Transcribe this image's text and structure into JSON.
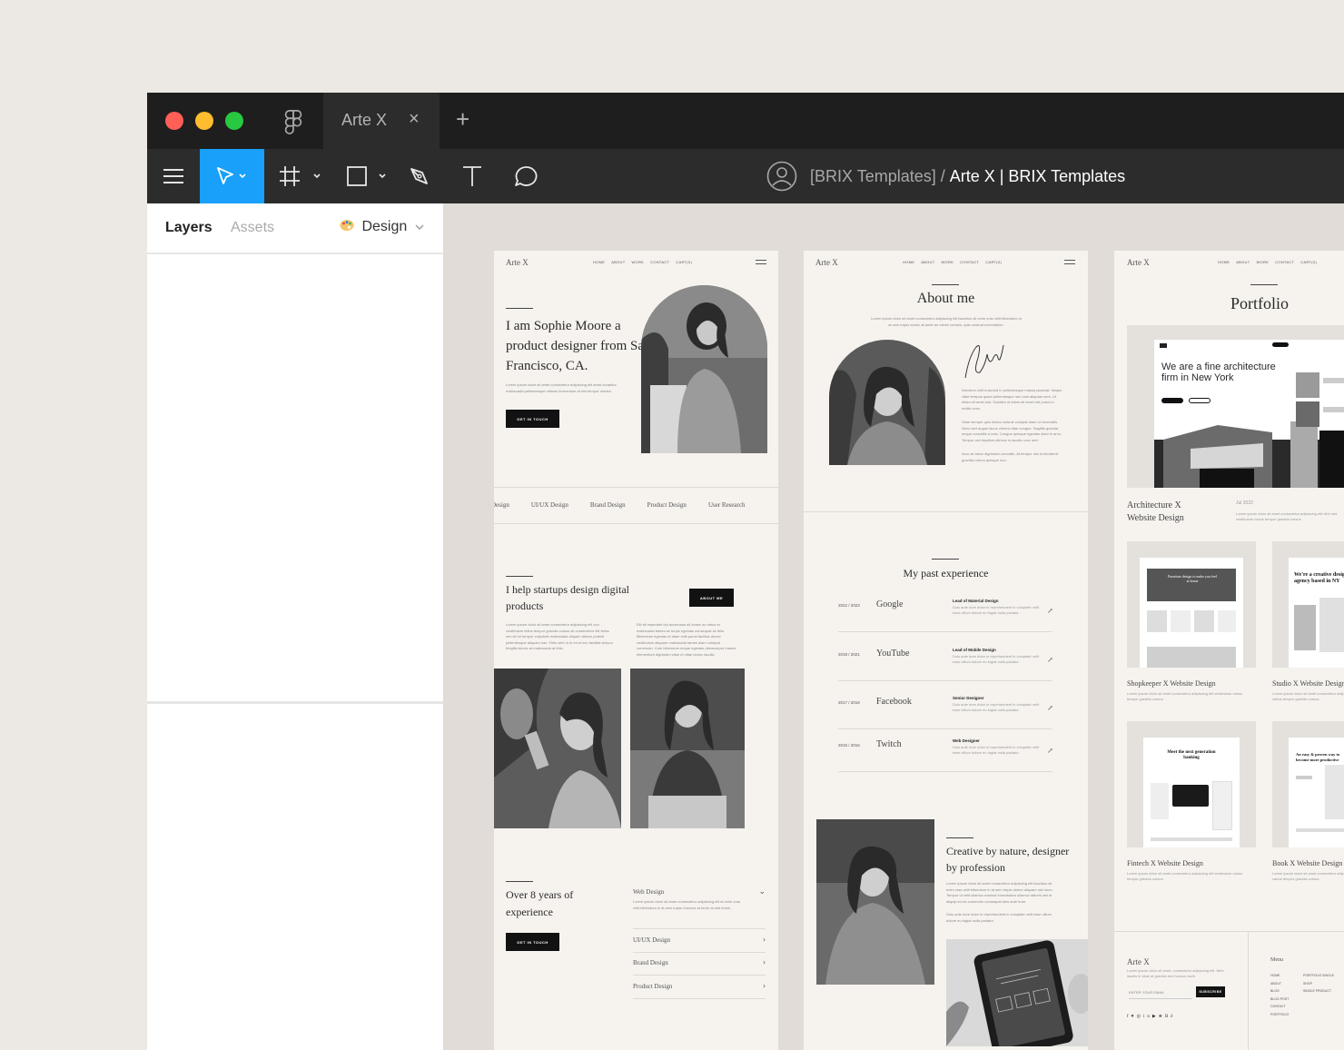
{
  "window": {
    "tab_label": "Arte X",
    "tab_close": "×",
    "add_tab": "+",
    "file_path": "[BRIX Templates] /",
    "file_name": "Arte X | BRIX Templates"
  },
  "toolbar": {
    "tools": [
      {
        "name": "menu-icon"
      },
      {
        "name": "move-tool-icon"
      },
      {
        "name": "frame-tool-icon"
      },
      {
        "name": "shape-tool-icon"
      },
      {
        "name": "pen-tool-icon"
      },
      {
        "name": "text-tool-icon"
      },
      {
        "name": "comment-tool-icon"
      }
    ],
    "active_color": "#18a0fb"
  },
  "panel": {
    "tabs": {
      "layers": "Layers",
      "assets": "Assets",
      "design": "Design"
    }
  },
  "frames": {
    "home": {
      "logo": "Arte X",
      "nav": [
        "HOME",
        "ABOUT",
        "WORK",
        "CONTACT",
        "CART(0)"
      ],
      "hero_title": "I am Sophie Moore a product designer from San Francisco, CA.",
      "hero_text": "Lorem ipsum dolor sit amet consectetur adipiscing elit amet curabitur malesuada pellentesque ultrices fermentum at nisi tempor viverra.",
      "hero_button": "GET IN TOUCH",
      "tags": [
        "Design",
        "UI/UX Design",
        "Brand Design",
        "Product Design",
        "User Research"
      ],
      "help_title": "I help startups design digital products",
      "about_button": "ABOUT ME",
      "help_text_1": "Lorem ipsum dolor sit amet consectetur adipiscing elit orci vestibulum tellus tempor gravida cursus sit consectetur elit tellus nec sit mi tempor vulputate malesuada aliquet ultrices potenti pellentesque aliquam hac. Felis nibh in in mi et nec facilisis tempor fringilla donec at malesuada at felis.",
      "help_text_2": "Elit sit imperdiet dui accumsan sit donec ac netus et malesuada fames ac turpis egestas consequat ac felis. Bibendum egestas et diam velit purus facilisis donec vestibulum aliquam malesuada fames diam volutpat commodo. Cum bibendum neque egestas ullamcorper mauris elementum dignissim vitae et vitae donec iaculis.",
      "exp_title": "Over 8 years of experience",
      "exp_button": "GET IN TOUCH",
      "accordion": [
        {
          "label": "Web Design",
          "text": "Lorem ipsum dolor sit amet consectetur adipiscing elit at enim cras velit bibendum in at sem turpis rhoncus at tortor at sed lorem."
        },
        {
          "label": "UI/UX Design",
          "text": ""
        },
        {
          "label": "Brand Design",
          "text": ""
        },
        {
          "label": "Product Design",
          "text": ""
        }
      ]
    },
    "about": {
      "logo": "Arte X",
      "nav": [
        "HOME",
        "ABOUT",
        "WORK",
        "CONTACT",
        "CART(0)"
      ],
      "title": "About me",
      "intro": "Lorem ipsum dolor sit amet consectetur adipiscing elit faucibus sit enim cras velit bibendum in at sem turpis donec at amet an minim veniam, quis nostrud exercitation.",
      "bio_1": "Interdum velit euismod in pellentesque massa placerat. Neque vitae tempus quam pellentesque nec nam aliquam sem. Ut etiam sit amet nisl. Sodales ut etiam sit amet nisl purus in mollis nunc.",
      "bio_2": "Vitae semper quis lectus nulla at volutpat diam ut venenatis. Nunc sed augue lacus viverra vitae congue. Sagittis gravida neque convallis a cras. Congue quisque egestas diam in arcu. Tempor orci dapibus ultrices in iaculis nunc sed.",
      "bio_3": "Arcu ac tortor dignissim convallis. At tempor nisi in hendrerit gravida rutrum quisque non.",
      "exp_title": "My past experience",
      "experience": [
        {
          "years": "2022 / 2023",
          "company": "Google",
          "role": "Lead of Material Design",
          "desc": "Duis aute irure dolor in reprehenderit in voluptate velit esse cillum dolore eu fugiat nulla pariatur.",
          "arrow": "↗"
        },
        {
          "years": "2019 / 2021",
          "company": "YouTube",
          "role": "Lead of Mobile Design",
          "desc": "Duis aute irure dolor in reprehenderit in voluptate velit esse cillum dolore eu fugiat nulla pariatur.",
          "arrow": "↗"
        },
        {
          "years": "2017 / 2018",
          "company": "Facebook",
          "role": "Senior Designer",
          "desc": "Duis aute irure dolor in reprehenderit in voluptate velit esse cillum dolore eu fugiat nulla pariatur.",
          "arrow": "↗"
        },
        {
          "years": "2015 / 2016",
          "company": "Twitch",
          "role": "Web Designer",
          "desc": "Duis aute irure dolor in reprehenderit in voluptate velit esse cillum dolore eu fugiat nulla pariatur.",
          "arrow": "↗"
        }
      ],
      "creative_title": "Creative by nature, designer by profession",
      "creative_text": "Lorem ipsum dolor sit amet consectetur adipiscing elit faucibus sit enim cras velit bibendum in at sem turpis donec aliquam nisl nunc. Tempor ut velit ullamco nostrud exercitation ullamco laboris nisi ut aliquip ex ea commodo consequat duis aute irure.",
      "creative_text_2": "Duis aute irure dolor in reprehenderit in voluptate velit esse cillum dolore eu fugiat nulla pariatur."
    },
    "portfolio": {
      "logo": "Arte X",
      "nav": [
        "HOME",
        "ABOUT",
        "WORK",
        "CONTACT",
        "CART(0)"
      ],
      "title": "Portfolio",
      "featured_headline": "We are a fine architecture firm in New York",
      "featured_title": "Architecture X Website Design",
      "featured_date": "Jul 2022",
      "featured_text": "Lorem ipsum dolor sit amet consectetur adipiscing elit nibh sed vestibulum varius tempor gravida cursus.",
      "cards": [
        {
          "title": "Shopkeeper X Website Design",
          "text": "Lorem ipsum dolor sit amet consectetur adipiscing elit vestibulum varius tempor gravida cursus.",
          "headline": "Furniture design to make you feel at home"
        },
        {
          "title": "Studio X Website Design",
          "text": "Lorem ipsum dolor sit amet consectetur adipiscing elit vestibulum varius tempor gravida cursus.",
          "headline": "We're a creative design agency based in NY"
        },
        {
          "title": "Fintech X Website Design",
          "text": "Lorem ipsum dolor sit amet consectetur adipiscing elit vestibulum varius tempor gravida cursus.",
          "headline": "Meet the next generation banking"
        },
        {
          "title": "Book X Website Design",
          "text": "Lorem ipsum dolor sit amet consectetur adipiscing elit vestibulum varius tempor gravida cursus.",
          "headline": "An easy & proven way to become more productive"
        }
      ],
      "footer_logo": "Arte X",
      "footer_text": "Lorem ipsum dolor sit amet, consectetur adipiscing elit. Nibh iaculis in vitae at gravida est rhoncus taciti.",
      "email_placeholder": "ENTER YOUR EMAIL",
      "subscribe_button": "SUBSCRIBE",
      "menu_title": "Menu",
      "menu_col_1": [
        "HOME",
        "ABOUT",
        "BLOG",
        "BLOG POST",
        "CONTACT",
        "PORTFOLIO"
      ],
      "menu_col_2": [
        "PORTFOLIO SINGLE",
        "SHOP",
        "SINGLE PRODUCT"
      ],
      "social_icons": [
        "facebook-icon",
        "twitter-icon",
        "instagram-icon",
        "linkedin-icon",
        "youtube-icon",
        "dribbble-icon",
        "behance-icon"
      ]
    }
  }
}
